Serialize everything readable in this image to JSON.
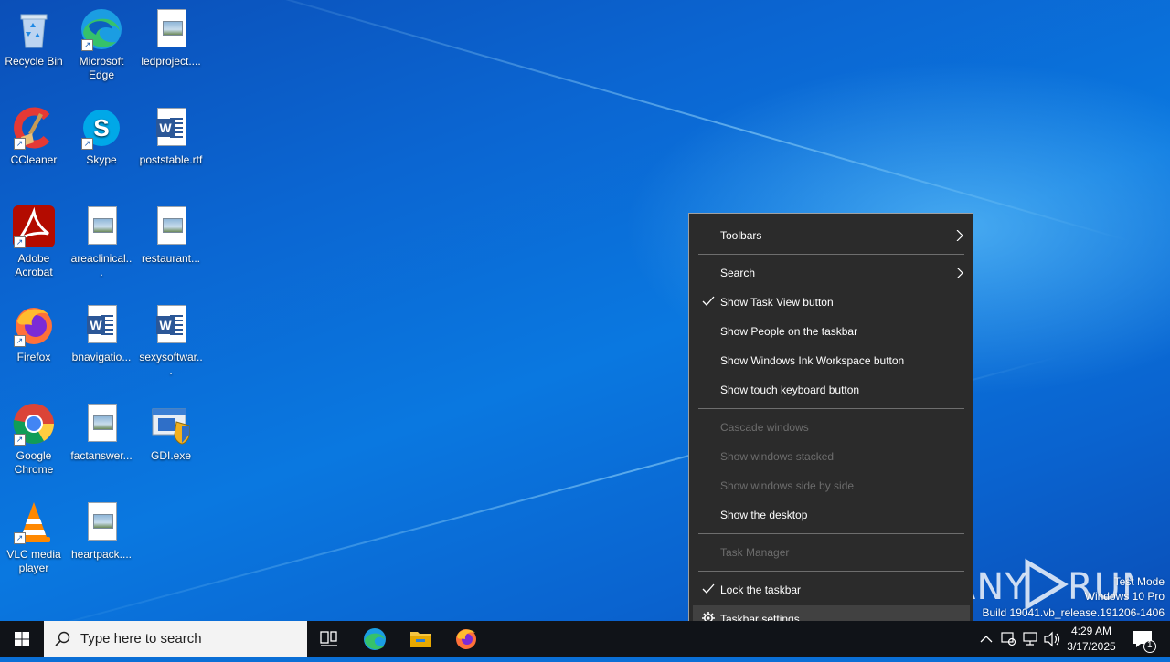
{
  "desktop": {
    "icons": [
      {
        "label": "Recycle Bin"
      },
      {
        "label": "Microsoft Edge"
      },
      {
        "label": "ledproject...."
      },
      {
        "label": "CCleaner"
      },
      {
        "label": "Skype"
      },
      {
        "label": "poststable.rtf"
      },
      {
        "label": "Adobe Acrobat"
      },
      {
        "label": "areaclinical..."
      },
      {
        "label": "restaurant..."
      },
      {
        "label": "Firefox"
      },
      {
        "label": "bnavigatio..."
      },
      {
        "label": "sexysoftwar..."
      },
      {
        "label": "Google Chrome"
      },
      {
        "label": "factanswer..."
      },
      {
        "label": "GDI.exe"
      },
      {
        "label": "VLC media player"
      },
      {
        "label": "heartpack...."
      }
    ]
  },
  "context_menu": {
    "items": [
      {
        "label": "Toolbars",
        "submenu": true,
        "checked": false,
        "enabled": true
      },
      {
        "label": "Search",
        "submenu": true,
        "checked": false,
        "enabled": true
      },
      {
        "label": "Show Task View button",
        "submenu": false,
        "checked": true,
        "enabled": true
      },
      {
        "label": "Show People on the taskbar",
        "submenu": false,
        "checked": false,
        "enabled": true
      },
      {
        "label": "Show Windows Ink Workspace button",
        "submenu": false,
        "checked": false,
        "enabled": true
      },
      {
        "label": "Show touch keyboard button",
        "submenu": false,
        "checked": false,
        "enabled": true
      },
      {
        "label": "Cascade windows",
        "submenu": false,
        "checked": false,
        "enabled": false
      },
      {
        "label": "Show windows stacked",
        "submenu": false,
        "checked": false,
        "enabled": false
      },
      {
        "label": "Show windows side by side",
        "submenu": false,
        "checked": false,
        "enabled": false
      },
      {
        "label": "Show the desktop",
        "submenu": false,
        "checked": false,
        "enabled": true
      },
      {
        "label": "Task Manager",
        "submenu": false,
        "checked": false,
        "enabled": false
      },
      {
        "label": "Lock the taskbar",
        "submenu": false,
        "checked": true,
        "enabled": true
      },
      {
        "label": "Taskbar settings",
        "submenu": false,
        "checked": false,
        "enabled": true,
        "icon": "gear-icon",
        "highlighted": true
      }
    ]
  },
  "taskbar": {
    "search_placeholder": "Type here to search",
    "pinned": [
      "task-view-icon",
      "edge-icon",
      "file-explorer-icon",
      "firefox-icon"
    ],
    "clock_time": "4:29 AM",
    "clock_date": "3/17/2025",
    "notification_count": "1"
  },
  "watermark": {
    "line1": "Test Mode",
    "line2": "Windows 10 Pro",
    "line3": "Build 19041.vb_release.191206-1406",
    "brand": "ANY RUN"
  },
  "colors": {
    "menu_bg": "#2b2b2b",
    "menu_hover": "#414141",
    "taskbar_bg": "#101318",
    "desktop_blue": "#0a6fd6"
  }
}
